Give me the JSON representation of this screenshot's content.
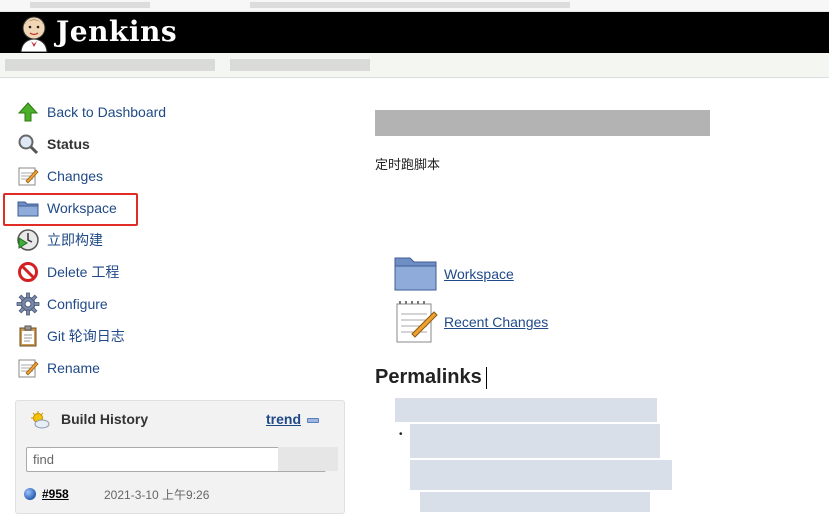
{
  "header": {
    "logo_text": "Jenkins"
  },
  "tasks": [
    {
      "label": "Back to Dashboard",
      "icon": "up-arrow-icon"
    },
    {
      "label": "Status",
      "icon": "magnifier-icon"
    },
    {
      "label": "Changes",
      "icon": "notepad-icon"
    },
    {
      "label": "Workspace",
      "icon": "folder-icon"
    },
    {
      "label": "立即构建",
      "icon": "build-clock-icon"
    },
    {
      "label": "Delete 工程",
      "icon": "no-entry-icon"
    },
    {
      "label": "Configure",
      "icon": "gear-icon"
    },
    {
      "label": "Git 轮询日志",
      "icon": "clipboard-icon"
    },
    {
      "label": "Rename",
      "icon": "notepad-icon"
    }
  ],
  "build_history": {
    "title": "Build History",
    "trend_label": "trend",
    "search_placeholder": "find",
    "builds": [
      {
        "number": "#958",
        "time": "2021-3-10 上午9:26",
        "status_color": "#2a5db0"
      }
    ]
  },
  "main": {
    "description": "定时跑脚本",
    "links": [
      {
        "label": "Workspace",
        "icon": "folder-icon"
      },
      {
        "label": "Recent Changes",
        "icon": "notepad-icon"
      }
    ],
    "permalinks_heading": "Permalinks",
    "bullet": "•"
  },
  "colors": {
    "header_bg": "#000000",
    "link": "#204a87",
    "highlight": "#e02b27"
  }
}
